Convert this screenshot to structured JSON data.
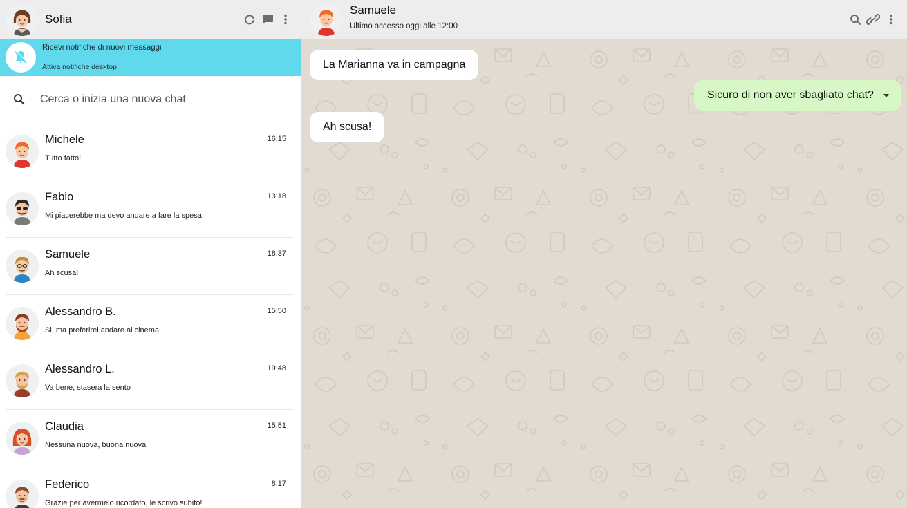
{
  "user": {
    "name": "Sofia"
  },
  "notification": {
    "title": "Ricevi notifiche di nuovi messaggi",
    "link": "Attiva notifiche desktop"
  },
  "search": {
    "placeholder": "Cerca o inizia una nuova chat"
  },
  "chats": [
    {
      "name": "Michele",
      "time": "16:15",
      "preview": "Tutto fatto!"
    },
    {
      "name": "Fabio",
      "time": "13:18",
      "preview": "Mi piacerebbe ma devo andare a fare la spesa."
    },
    {
      "name": "Samuele",
      "time": "18:37",
      "preview": "Ah scusa!"
    },
    {
      "name": "Alessandro B.",
      "time": "15:50",
      "preview": "Si, ma preferirei andare al cinema"
    },
    {
      "name": "Alessandro L.",
      "time": "19:48",
      "preview": "Va bene, stasera la sento"
    },
    {
      "name": "Claudia",
      "time": "15:51",
      "preview": "Nessuna nuova, buona nuova"
    },
    {
      "name": "Federico",
      "time": "8:17",
      "preview": "Grazie per avermelo ricordato, le scrivo subito!"
    }
  ],
  "active_chat": {
    "name": "Samuele",
    "last_seen": "Ultimo accesso oggi alle 12:00",
    "messages": [
      {
        "direction": "in",
        "text": "La Marianna va in campagna"
      },
      {
        "direction": "out",
        "text": "Sicuro di non aver sbagliato chat?"
      },
      {
        "direction": "in",
        "text": "Ah scusa!"
      }
    ]
  },
  "icons": {
    "sidebar_header": [
      "refresh-icon",
      "chat-icon",
      "menu-dots-icon"
    ],
    "chat_header": [
      "search-icon",
      "attach-icon",
      "menu-dots-icon"
    ],
    "notification": "bell-off-icon"
  },
  "colors": {
    "header_bg": "#ededed",
    "notification_bg": "#5fd9eb",
    "chat_bg": "#e2dbd2",
    "outgoing_bubble": "#d7f8c6",
    "incoming_bubble": "#ffffff"
  }
}
